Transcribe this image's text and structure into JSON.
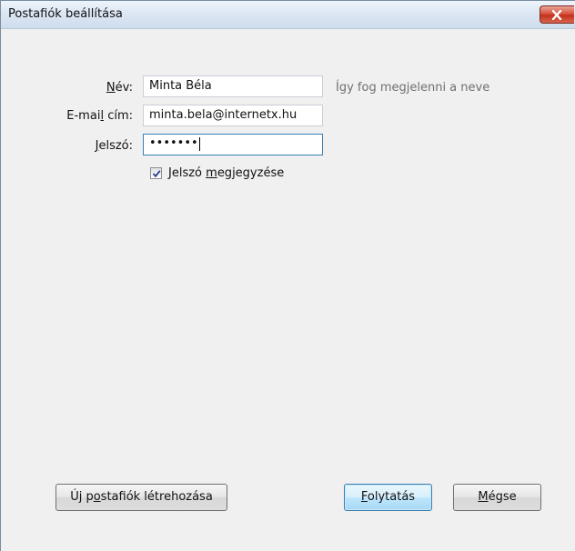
{
  "window": {
    "title": "Postafiók beállítása"
  },
  "form": {
    "name_label_pre": "",
    "name_label_accel": "N",
    "name_label_post": "év:",
    "name_value": "Minta Béla",
    "name_hint": "Így fog megjelenni a neve",
    "email_label_pre": "E-mai",
    "email_label_accel": "l",
    "email_label_post": " cím:",
    "email_value": "minta.bela@internetx.hu",
    "password_label_pre": "",
    "password_label_accel": "J",
    "password_label_post": "elszó:",
    "password_value": "•••••••",
    "remember_label_pre": "Jelszó ",
    "remember_label_accel": "m",
    "remember_label_post": "egjegyzése",
    "remember_checked": true
  },
  "buttons": {
    "new_account_pre": "Új p",
    "new_account_accel": "o",
    "new_account_post": "stafiók létrehozása",
    "continue_pre": "",
    "continue_accel": "F",
    "continue_post": "olytatás",
    "cancel_pre": "",
    "cancel_accel": "M",
    "cancel_post": "égse"
  },
  "icons": {
    "close": "close-x-icon",
    "checkbox": "checkmark-icon"
  },
  "colors": {
    "close_button": "#c3321c",
    "default_button_border": "#3c7fb1",
    "hint_text": "#707070"
  }
}
